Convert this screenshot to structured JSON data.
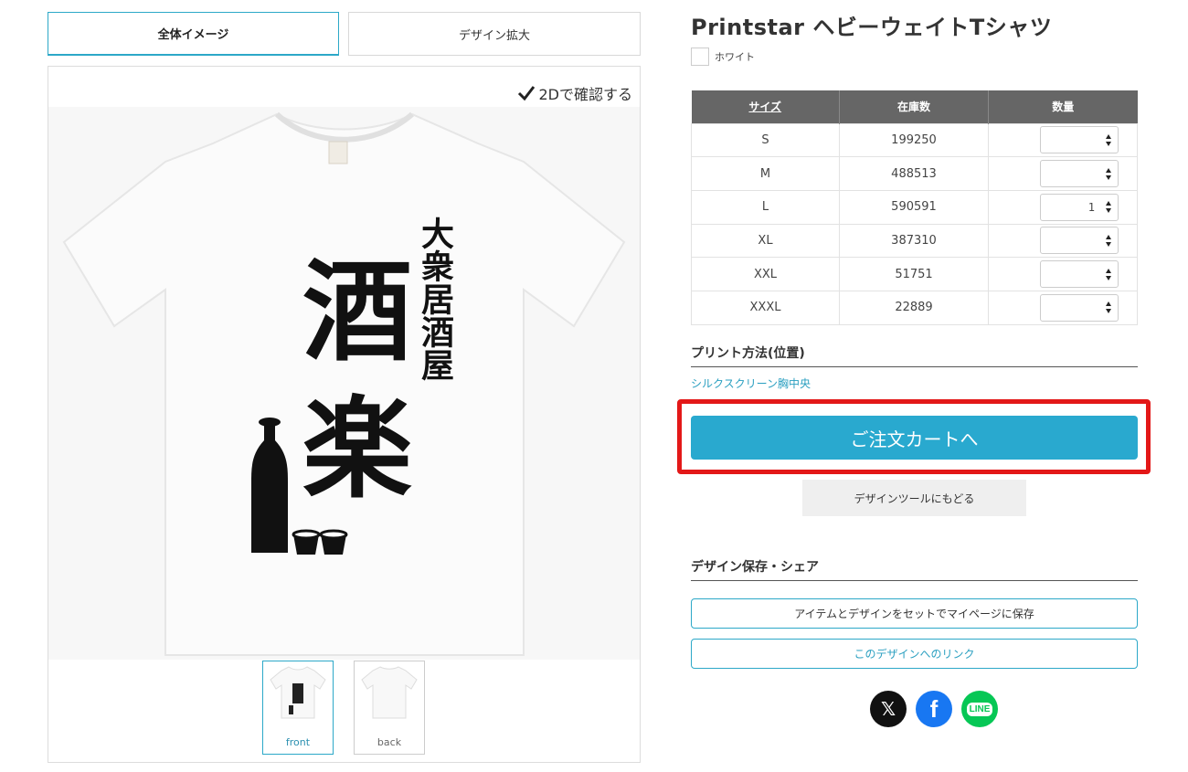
{
  "view_tabs": {
    "overall": "全体イメージ",
    "zoom": "デザイン拡大"
  },
  "preview": {
    "check_2d_label": "2Dで確認する",
    "design_main": [
      "酒",
      "楽"
    ],
    "design_sub": "大衆居酒屋",
    "thumbnails": [
      {
        "label": "front"
      },
      {
        "label": "back"
      }
    ]
  },
  "product": {
    "title": "Printstar ヘビーウェイトTシャツ",
    "color_name": "ホワイト"
  },
  "stock_table": {
    "headers": {
      "size": "サイズ",
      "stock": "在庫数",
      "qty": "数量"
    },
    "rows": [
      {
        "size": "S",
        "stock": "199250",
        "qty": ""
      },
      {
        "size": "M",
        "stock": "488513",
        "qty": ""
      },
      {
        "size": "L",
        "stock": "590591",
        "qty": "1"
      },
      {
        "size": "XL",
        "stock": "387310",
        "qty": ""
      },
      {
        "size": "XXL",
        "stock": "51751",
        "qty": ""
      },
      {
        "size": "XXXL",
        "stock": "22889",
        "qty": ""
      }
    ]
  },
  "print_method": {
    "heading": "プリント方法(位置)",
    "value": "シルクスクリーン胸中央"
  },
  "buttons": {
    "cart": "ご注文カートへ",
    "back_to_tool": "デザインツールにもどる"
  },
  "save_share": {
    "heading": "デザイン保存・シェア",
    "save_button": "アイテムとデザインをセットでマイページに保存",
    "link_button": "このデザインへのリンク"
  },
  "social": {
    "x_glyph": "𝕏",
    "facebook_glyph": "f",
    "line_glyph": "LINE"
  },
  "colors": {
    "accent": "#29a9cf",
    "highlight": "#e31818",
    "table_header": "#666666"
  }
}
